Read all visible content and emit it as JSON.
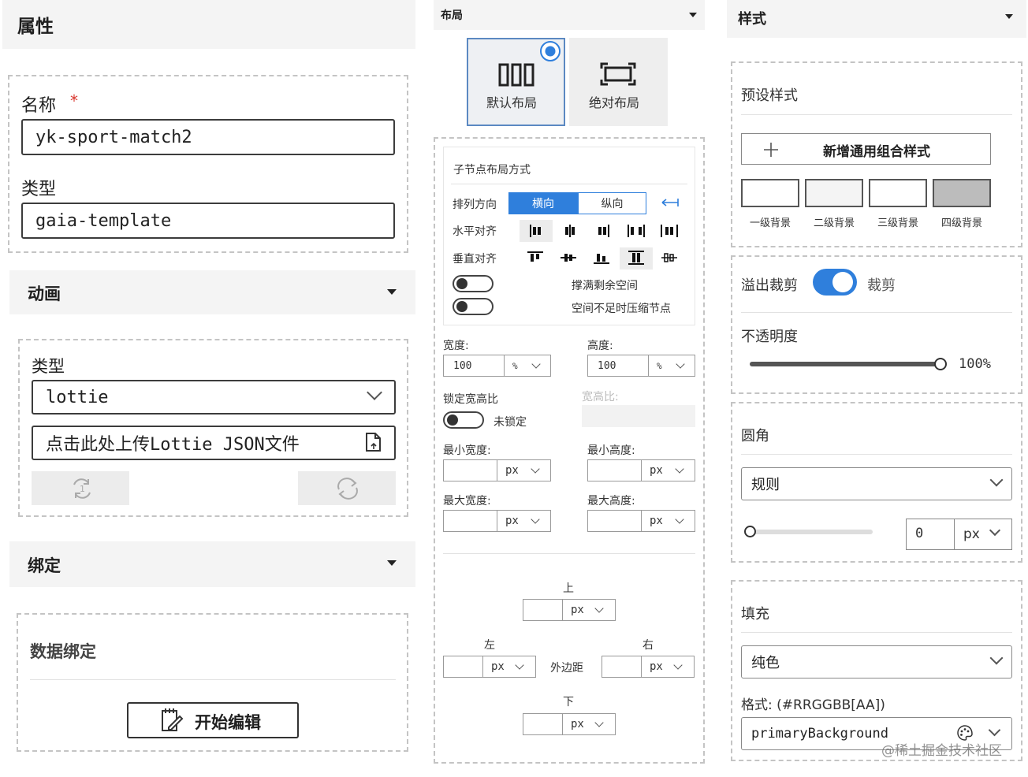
{
  "left": {
    "title": "属性",
    "name_label": "名称",
    "required_mark": "*",
    "name_value": "yk-sport-match2",
    "type_label": "类型",
    "type_value": "gaia-template",
    "animation": {
      "header": "动画",
      "type_label": "类型",
      "type_value": "lottie",
      "upload_label": "点击此处上传Lottie JSON文件"
    },
    "binding": {
      "header": "绑定",
      "data_binding_title": "数据绑定",
      "edit_button": "开始编辑"
    }
  },
  "layout": {
    "dropdown_label": "布局",
    "default_layout": "默认布局",
    "absolute_layout": "绝对布局",
    "selected_layout": "默认布局",
    "child_layout_title": "子节点布局方式",
    "direction_label": "排列方向",
    "direction_options": [
      "横向",
      "纵向"
    ],
    "direction_selected": "横向",
    "h_align_label": "水平对齐",
    "v_align_label": "垂直对齐",
    "fill_space_label": "撑满剩余空间",
    "shrink_label": "空间不足时压缩节点",
    "width_label": "宽度:",
    "width_value": "100",
    "width_unit": "%",
    "height_label": "高度:",
    "height_value": "100",
    "height_unit": "%",
    "lock_ratio_label": "锁定宽高比",
    "lock_state": "未锁定",
    "ratio_label": "宽高比:",
    "min_width_label": "最小宽度:",
    "min_height_label": "最小高度:",
    "max_width_label": "最大宽度:",
    "max_height_label": "最大高度:",
    "unit_px": "px",
    "margin": {
      "top": "上",
      "left": "左",
      "right": "右",
      "bottom": "下",
      "center": "外边距"
    }
  },
  "style": {
    "dropdown_label": "样式",
    "preset_title": "预设样式",
    "add_preset_button": "新增通用组合样式",
    "backgrounds": [
      {
        "label": "一级背景",
        "color": "#ffffff"
      },
      {
        "label": "二级背景",
        "color": "#f4f4f4"
      },
      {
        "label": "三级背景",
        "color": "#ffffff"
      },
      {
        "label": "四级背景",
        "color": "#bcbcbc"
      }
    ],
    "overflow_label": "溢出裁剪",
    "overflow_toggle_on": true,
    "overflow_state": "裁剪",
    "opacity_label": "不透明度",
    "opacity_value": "100%",
    "opacity_fraction": 1.0,
    "radius_title": "圆角",
    "radius_mode": "规则",
    "radius_value": "0",
    "radius_unit": "px",
    "fill_title": "填充",
    "fill_mode": "纯色",
    "format_label": "格式: (#RRGGBB[AA])",
    "fill_value": "primaryBackground"
  },
  "watermark": "@稀土掘金技术社区",
  "colors": {
    "accent": "#2f7fdc",
    "required": "#d9372f"
  }
}
